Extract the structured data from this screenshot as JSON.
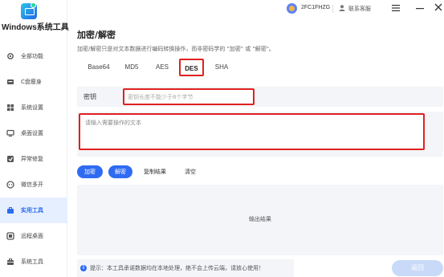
{
  "app": {
    "title": "Windows系统工具"
  },
  "sidebar": {
    "items": [
      {
        "label": "全部功能",
        "icon": "gear-icon",
        "active": false
      },
      {
        "label": "C盘瘦身",
        "icon": "drive-icon",
        "active": false
      },
      {
        "label": "系统设置",
        "icon": "grid-icon",
        "active": false
      },
      {
        "label": "桌面设置",
        "icon": "monitor-icon",
        "active": false
      },
      {
        "label": "异常修复",
        "icon": "repair-icon",
        "active": false
      },
      {
        "label": "微信多开",
        "icon": "chat-icon",
        "active": false
      },
      {
        "label": "实用工具",
        "icon": "toolbox-icon",
        "active": true
      },
      {
        "label": "远程桌面",
        "icon": "remote-icon",
        "active": false
      },
      {
        "label": "系统工具",
        "icon": "briefcase-icon",
        "active": false
      }
    ]
  },
  "header": {
    "user_code": "2FC1FHZG",
    "service_label": "联系客服"
  },
  "main": {
    "title": "加密/解密",
    "description": "加密/解密只是对文本数据进行编码转换操作，而非密码学的 \"加密\" 或 \"解密\"。",
    "tabs": [
      {
        "label": "Base64"
      },
      {
        "label": "MD5"
      },
      {
        "label": "AES"
      },
      {
        "label": "DES"
      },
      {
        "label": "SHA"
      }
    ],
    "active_tab": "DES",
    "key_label": "密钥",
    "key_placeholder": "密钥长度不能少于8个字节",
    "text_placeholder": "请输入需要操作的文本",
    "buttons": {
      "encrypt": "加密",
      "decrypt": "解密",
      "copy": "复制结果",
      "clear": "清空"
    },
    "output_label": "输出结果",
    "notice": "提示：本工具承诺数据均在本地处理，绝不会上传云端，请放心使用！",
    "back_label": "返回"
  },
  "colors": {
    "accent": "#2f6bf2",
    "highlight": "#e02020",
    "active_nav_bg": "#e6efff"
  }
}
